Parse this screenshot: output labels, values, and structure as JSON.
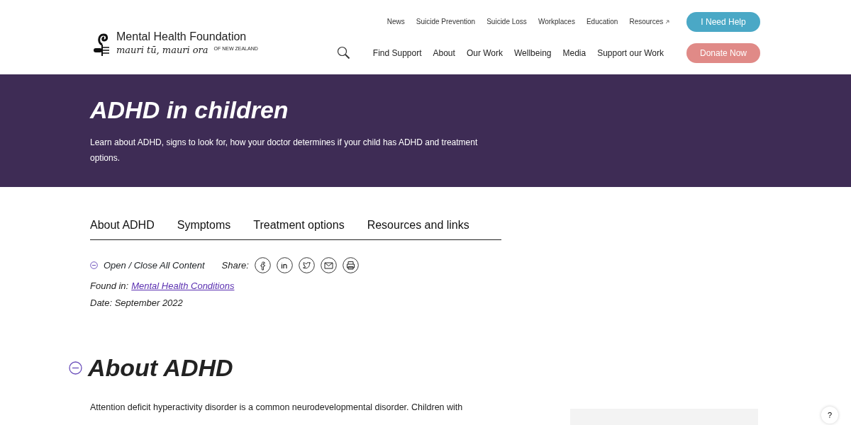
{
  "header": {
    "logo": {
      "name": "Mental Health Foundation",
      "tagline": "mauri tū, mauri ora",
      "country": "OF NEW ZEALAND"
    },
    "top_links": [
      {
        "label": "News",
        "external": false
      },
      {
        "label": "Suicide Prevention",
        "external": false
      },
      {
        "label": "Suicide Loss",
        "external": false
      },
      {
        "label": "Workplaces",
        "external": false
      },
      {
        "label": "Education",
        "external": false
      },
      {
        "label": "Resources",
        "external": true
      }
    ],
    "help_button": "I Need Help",
    "main_nav": [
      "Find Support",
      "About",
      "Our Work",
      "Wellbeing",
      "Media",
      "Support our Work"
    ],
    "donate_button": "Donate Now"
  },
  "banner": {
    "title": "ADHD in children",
    "subtitle": "Learn about ADHD, signs to look for, how your doctor determines if your child has ADHD and treatment options."
  },
  "tabs": [
    "About ADHD",
    "Symptoms",
    "Treatment options",
    "Resources and links"
  ],
  "toolbar": {
    "toggle": "Open / Close All Content",
    "share_label": "Share:",
    "share": [
      {
        "kind": "facebook"
      },
      {
        "kind": "linkedin"
      },
      {
        "kind": "twitter"
      },
      {
        "kind": "email"
      },
      {
        "kind": "print"
      }
    ]
  },
  "found_in": {
    "label": "Found in:",
    "link": "Mental Health Conditions"
  },
  "date": "Date: September 2022",
  "section": {
    "title": "About ADHD",
    "body": "Attention deficit hyperactivity disorder is a common neurodevelopmental disorder. Children with"
  },
  "help_fab": "?"
}
